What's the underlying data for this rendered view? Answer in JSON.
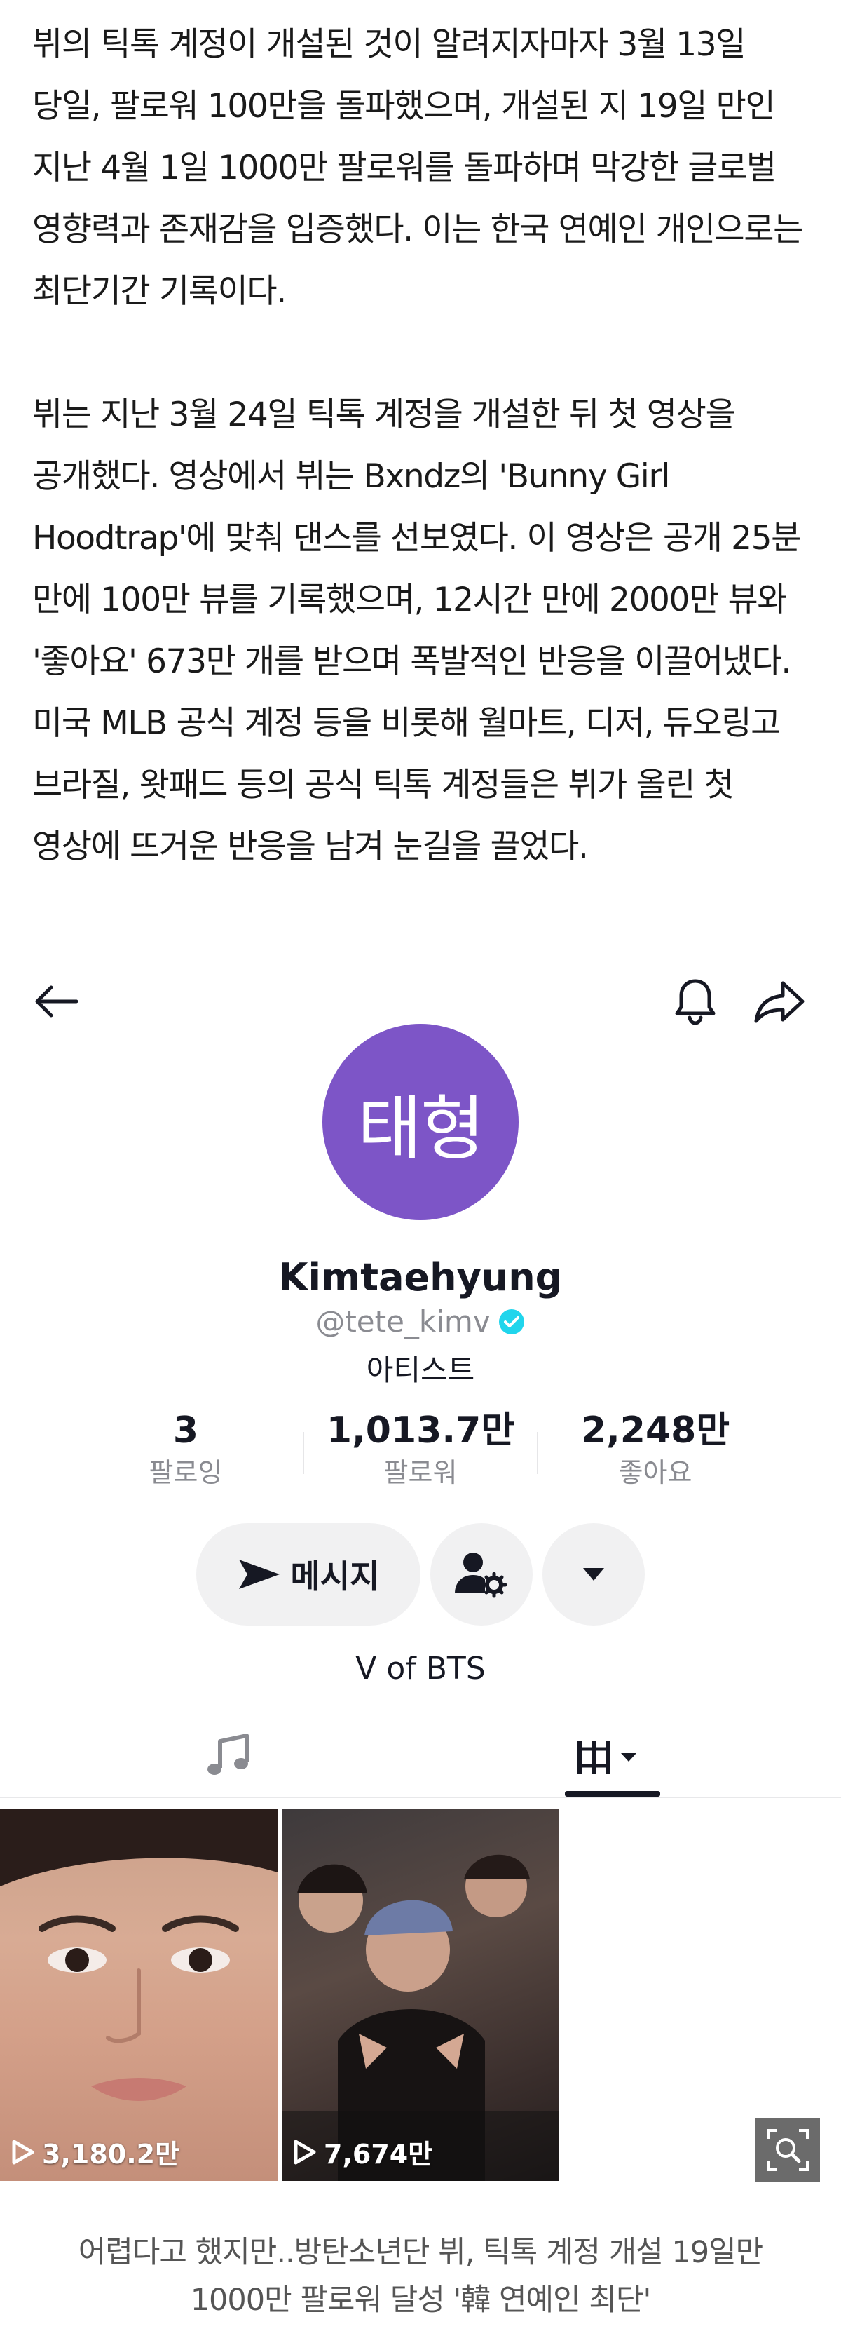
{
  "article": {
    "paragraphs": [
      "뷔의 틱톡 계정이 개설된 것이 알려지자마자 3월 13일 당일, 팔로워 100만을 돌파했으며, 개설된 지 19일 만인 지난 4월 1일 1000만 팔로워를 돌파하며 막강한 글로벌 영향력과 존재감을 입증했다. 이는 한국 연예인 개인으로는 최단기간 기록이다.",
      "뷔는 지난 3월 24일 틱톡 계정을 개설한 뒤 첫 영상을 공개했다. 영상에서 뷔는 Bxndz의 'Bunny Girl Hoodtrap'에 맞춰 댄스를 선보였다. 이 영상은 공개 25분 만에 100만 뷰를 기록했으며, 12시간 만에 2000만 뷰와 '좋아요' 673만 개를 받으며 폭발적인 반응을 이끌어냈다. 미국 MLB 공식 계정 등을 비롯해 월마트, 디저, 듀오링고 브라질, 왓패드 등의 공식 틱톡 계정들은 뷔가 올린 첫 영상에 뜨거운 반응을 남겨 눈길을 끌었다."
    ]
  },
  "profile": {
    "avatar_text": "태형",
    "avatar_color": "#7d55c7",
    "name": "Kimtaehyung",
    "handle": "@tete_kimv",
    "verified_color": "#20d5ec",
    "category": "아티스트",
    "bio": "V of BTS"
  },
  "stats": [
    {
      "value": "3",
      "label": "팔로잉"
    },
    {
      "value": "1,013.7만",
      "label": "팔로워"
    },
    {
      "value": "2,248만",
      "label": "좋아요"
    }
  ],
  "buttons": {
    "message_label": "메시지",
    "add_friend_icon": "person-gear-icon",
    "more_icon": "caret-down-icon"
  },
  "topbar": {
    "back_icon": "arrow-left-icon",
    "bell_icon": "bell-icon",
    "share_icon": "share-arrow-icon"
  },
  "tabs": [
    {
      "name": "music",
      "icon": "music-note-icon"
    },
    {
      "name": "videos",
      "icon": "grid-bars-icon",
      "active": true
    }
  ],
  "videos": [
    {
      "views": "3,180.2만"
    },
    {
      "views": "7,674만"
    }
  ],
  "caption": {
    "line1": "어렵다고 했지만..방탄소년단 뷔, 틱톡 계정 개설 19일만",
    "line2": "1000만 팔로워 달성 '韓 연예인 최단'"
  }
}
